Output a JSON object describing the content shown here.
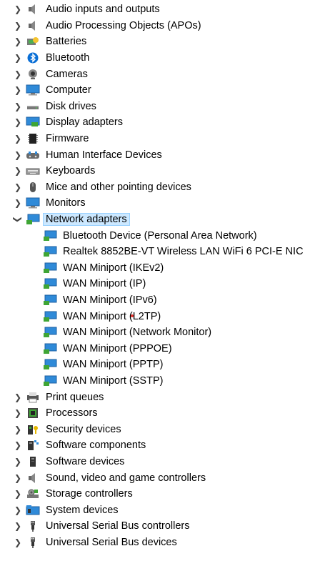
{
  "tree": {
    "items": [
      {
        "label": "Audio inputs and outputs",
        "icon": "speaker-icon",
        "expanded": false
      },
      {
        "label": "Audio Processing Objects (APOs)",
        "icon": "speaker-icon",
        "expanded": false
      },
      {
        "label": "Batteries",
        "icon": "battery-icon",
        "expanded": false
      },
      {
        "label": "Bluetooth",
        "icon": "bluetooth-icon",
        "expanded": false
      },
      {
        "label": "Cameras",
        "icon": "camera-icon",
        "expanded": false
      },
      {
        "label": "Computer",
        "icon": "monitor-icon",
        "expanded": false
      },
      {
        "label": "Disk drives",
        "icon": "disk-drive-icon",
        "expanded": false
      },
      {
        "label": "Display adapters",
        "icon": "display-adapter-icon",
        "expanded": false
      },
      {
        "label": "Firmware",
        "icon": "firmware-chip-icon",
        "expanded": false
      },
      {
        "label": "Human Interface Devices",
        "icon": "hid-icon",
        "expanded": false
      },
      {
        "label": "Keyboards",
        "icon": "keyboard-icon",
        "expanded": false
      },
      {
        "label": "Mice and other pointing devices",
        "icon": "mouse-icon",
        "expanded": false
      },
      {
        "label": "Monitors",
        "icon": "monitor-icon",
        "expanded": false
      },
      {
        "label": "Network adapters",
        "icon": "network-adapter-icon",
        "expanded": true,
        "selected": true
      },
      {
        "label": "Print queues",
        "icon": "printer-icon",
        "expanded": false
      },
      {
        "label": "Processors",
        "icon": "processor-icon",
        "expanded": false
      },
      {
        "label": "Security devices",
        "icon": "security-key-icon",
        "expanded": false
      },
      {
        "label": "Software components",
        "icon": "software-component-icon",
        "expanded": false
      },
      {
        "label": "Software devices",
        "icon": "software-device-icon",
        "expanded": false
      },
      {
        "label": "Sound, video and game controllers",
        "icon": "speaker-icon",
        "expanded": false
      },
      {
        "label": "Storage controllers",
        "icon": "storage-controller-icon",
        "expanded": false
      },
      {
        "label": "System devices",
        "icon": "system-folder-icon",
        "expanded": false
      },
      {
        "label": "Universal Serial Bus controllers",
        "icon": "usb-icon",
        "expanded": false
      },
      {
        "label": "Universal Serial Bus devices",
        "icon": "usb-icon",
        "expanded": false
      }
    ],
    "network_children": [
      "Bluetooth Device (Personal Area Network)",
      "Realtek 8852BE-VT Wireless LAN WiFi 6 PCI-E NIC",
      "WAN Miniport (IKEv2)",
      "WAN Miniport (IP)",
      "WAN Miniport (IPv6)",
      "WAN Miniport (L2TP)",
      "WAN Miniport (Network Monitor)",
      "WAN Miniport (PPPOE)",
      "WAN Miniport (PPTP)",
      "WAN Miniport (SSTP)"
    ]
  },
  "colors": {
    "selection_bg": "#cce8ff",
    "selection_border": "#99d1ff",
    "network_green": "#3fa535",
    "network_blue": "#2f8ad8"
  }
}
